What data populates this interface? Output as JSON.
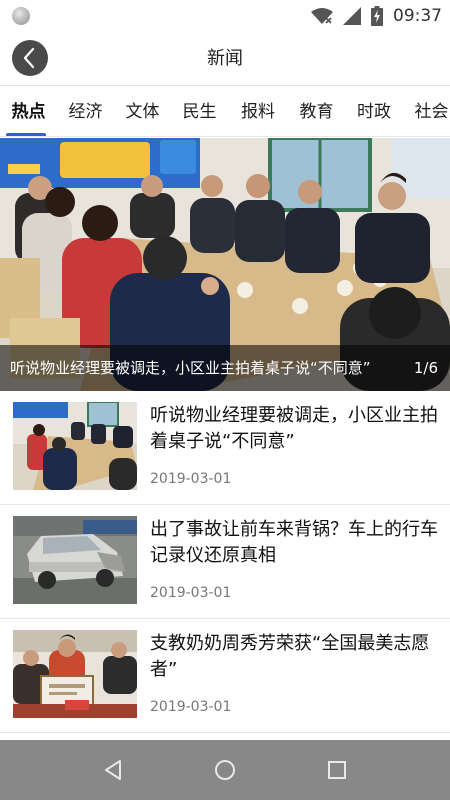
{
  "status_bar": {
    "time": "09:37",
    "icons": [
      "wifi-icon",
      "signal-icon",
      "battery-charging-icon"
    ]
  },
  "header": {
    "title": "新闻",
    "back_icon": "chevron-left-icon"
  },
  "tabs": [
    {
      "label": "热点",
      "active": true
    },
    {
      "label": "经济",
      "active": false
    },
    {
      "label": "文体",
      "active": false
    },
    {
      "label": "民生",
      "active": false
    },
    {
      "label": "报料",
      "active": false
    },
    {
      "label": "教育",
      "active": false
    },
    {
      "label": "时政",
      "active": false
    },
    {
      "label": "社会",
      "active": false
    }
  ],
  "banner": {
    "title": "听说物业经理要被调走，小区业主拍着桌子说“不同意”",
    "index": "1/6"
  },
  "news": [
    {
      "title": "听说物业经理要被调走，小区业主拍着桌子说“不同意”",
      "date": "2019-03-01"
    },
    {
      "title": "出了事故让前车来背锅？车上的行车记录仪还原真相",
      "date": "2019-03-01"
    },
    {
      "title": "支教奶奶周秀芳荣获“全国最美志愿者”",
      "date": "2019-03-01"
    }
  ],
  "nav": {
    "back": "nav-back-icon",
    "home": "nav-home-icon",
    "recents": "nav-recents-icon"
  },
  "colors": {
    "accent": "#2c62d8",
    "nav_bar": "#888888",
    "caption_overlay": "#000000"
  }
}
